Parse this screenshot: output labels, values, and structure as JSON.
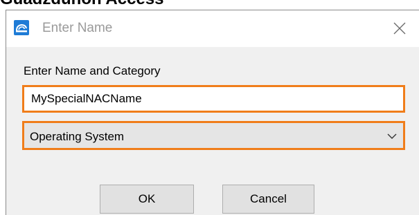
{
  "page": {
    "heading": "Guadzdunon Access"
  },
  "dialog": {
    "title": "Enter Name",
    "app_icon": "app-logo-icon",
    "close_icon": "close-icon",
    "section_label": "Enter Name and Category",
    "name_field": {
      "value": "MySpecialNACName"
    },
    "category_select": {
      "selected": "Operating System",
      "icon": "chevron-down-icon"
    },
    "buttons": {
      "ok_label": "OK",
      "cancel_label": "Cancel"
    }
  },
  "colors": {
    "focus_border": "#f07d1a",
    "app_icon_bg": "#1e7bd6",
    "dialog_bg": "#f0f0f0"
  }
}
